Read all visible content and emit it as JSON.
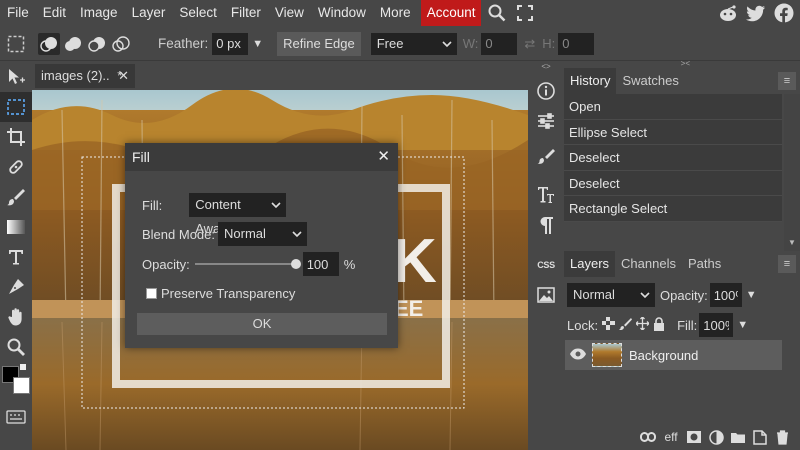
{
  "menubar": {
    "items": [
      "File",
      "Edit",
      "Image",
      "Layer",
      "Select",
      "Filter",
      "View",
      "Window",
      "More"
    ],
    "account": "Account"
  },
  "options": {
    "feather_label": "Feather:",
    "feather_value": "0 px",
    "refine_edge": "Refine Edge",
    "style_value": "Free",
    "w_label": "W:",
    "w_value": "0",
    "h_label": "H:",
    "h_value": "0"
  },
  "document": {
    "tab_title": "images (2)..",
    "modified_mark": "*",
    "close": "✕"
  },
  "history": {
    "tabs": [
      "History",
      "Swatches"
    ],
    "items": [
      "Open",
      "Ellipse Select",
      "Deselect",
      "Deselect",
      "Rectangle Select"
    ]
  },
  "layers": {
    "tabs": [
      "Layers",
      "Channels",
      "Paths"
    ],
    "blend_mode": "Normal",
    "opacity_label": "Opacity:",
    "opacity_value": "100%",
    "lock_label": "Lock:",
    "fill_label": "Fill:",
    "fill_value": "100%",
    "items": [
      {
        "name": "Background"
      }
    ]
  },
  "sidebar": {
    "css_label": "CSS"
  },
  "fill_dialog": {
    "title": "Fill",
    "close": "✕",
    "fill_label": "Fill:",
    "fill_value": "Content Aware",
    "blend_label": "Blend Mode:",
    "blend_value": "Normal",
    "opacity_label": "Opacity:",
    "opacity_value": "100",
    "opacity_unit": "%",
    "opacity_level": 1.0,
    "preserve_label": "Preserve Transparency",
    "preserve_checked": false,
    "ok_label": "OK"
  },
  "canvas_text": {
    "big_letter": "K",
    "small_text": "EE"
  },
  "colors": {
    "accent": "#c01a1a",
    "selection": "#5aa0e6",
    "foreground": "#000000",
    "background": "#ffffff"
  }
}
